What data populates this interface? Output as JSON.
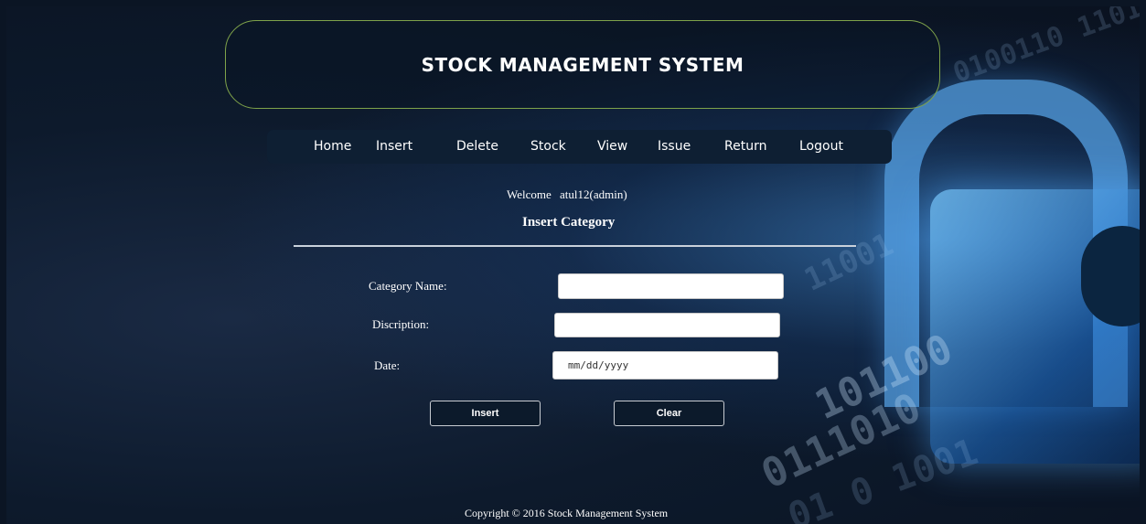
{
  "header": {
    "title": "STOCK MANAGEMENT SYSTEM"
  },
  "nav": {
    "items": [
      {
        "label": "Home"
      },
      {
        "label": "Insert"
      },
      {
        "label": "Delete"
      },
      {
        "label": "Stock"
      },
      {
        "label": "View"
      },
      {
        "label": "Issue"
      },
      {
        "label": "Return"
      },
      {
        "label": "Logout"
      }
    ]
  },
  "welcome": {
    "prefix": "Welcome",
    "user": "atul12(admin)"
  },
  "form": {
    "title": "Insert Category",
    "category_name_label": "Category Name:",
    "category_name_value": "",
    "description_label": "Discription:",
    "description_value": "",
    "date_label": "Date:",
    "date_placeholder": "mm/dd/yyyy",
    "insert_button": "Insert",
    "clear_button": "Clear"
  },
  "footer": {
    "text": "Copyright © 2016 Stock Management System"
  },
  "colors": {
    "background": "#0b1524",
    "header_border": "#7fa34a",
    "navbar": "#0e1f33",
    "button_bg": "#0c1a2b",
    "text": "#ffffff"
  }
}
